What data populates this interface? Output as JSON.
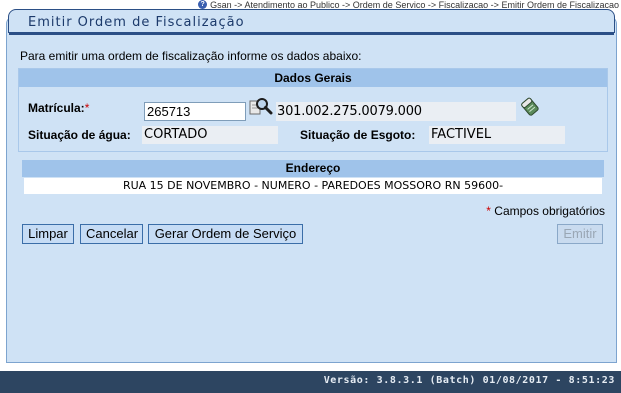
{
  "breadcrumb": {
    "items": [
      "Gsan",
      "Atendimento ao Publico",
      "Ordem de Servico",
      "Fiscalizacao",
      "Emitir Ordem de Fiscalizacao"
    ],
    "separator": "->"
  },
  "page": {
    "title": "Emitir Ordem de Fiscalização",
    "intro": "Para emitir uma ordem de fiscalização informe os dados abaixo:"
  },
  "dados_gerais": {
    "header": "Dados Gerais",
    "matricula_label": "Matrícula:",
    "matricula_required_mark": "*",
    "matricula_value": "265713",
    "matricula_description": "301.002.275.0079.000",
    "situacao_agua_label": "Situação de água:",
    "situacao_agua_value": "CORTADO",
    "situacao_esgoto_label": "Situação de Esgoto:",
    "situacao_esgoto_value": "FACTIVEL"
  },
  "endereco": {
    "header": "Endereço",
    "value": "RUA 15 DE NOVEMBRO - NUMERO -     PAREDOES MOSSORO RN 59600-"
  },
  "required_note": {
    "star": "*",
    "text": "Campos obrigatórios"
  },
  "buttons": {
    "limpar": "Limpar",
    "cancelar": "Cancelar",
    "gerar": "Gerar Ordem de Serviço",
    "emitir": "Emitir"
  },
  "footer": {
    "version": "Versão: 3.8.3.1 (Batch) 01/08/2017 - 8:51:23"
  },
  "icons": {
    "help": "help-icon",
    "search": "search-icon",
    "eraser": "eraser-icon"
  },
  "colors": {
    "panel_bg": "#cfe2f5",
    "section_header_bg": "#9fc3ea",
    "title_border": "#2b4f86",
    "footer_bg": "#2d4561",
    "required_star": "#cc0000"
  }
}
